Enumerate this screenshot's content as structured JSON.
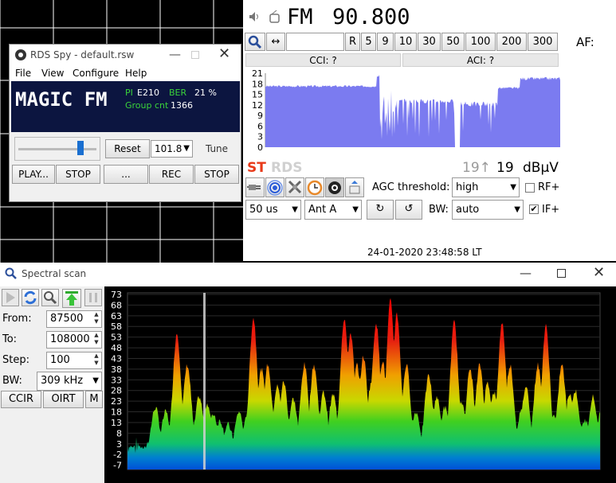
{
  "tuner": {
    "band": "FM",
    "frequency": "90.800",
    "freq_input": "",
    "buttons": [
      "R",
      "5",
      "9",
      "10",
      "30",
      "50",
      "100",
      "200",
      "300"
    ],
    "af_label": "AF:",
    "cci": "CCI: ?",
    "aci": "ACI: ?",
    "st": "ST",
    "rds": "RDS",
    "signal_peak": "19↑",
    "signal": "19",
    "unit": "dBµV",
    "agc_label": "AGC threshold:",
    "agc_value": "high",
    "rf_label": "RF+",
    "if_label": "IF+",
    "deemphasis": "50 us",
    "antenna": "Ant A",
    "bw_label": "BW:",
    "bw_value": "auto",
    "datetime": "24-01-2020 23:48:58 LT",
    "y_ticks": [
      "21",
      "18",
      "15",
      "12",
      "9",
      "6",
      "3",
      "0"
    ],
    "accent_color": "#e83a1a",
    "bar_color": "#7b7bf0"
  },
  "rds": {
    "title": "RDS Spy - default.rsw",
    "menu": [
      "File",
      "View",
      "Configure",
      "Help"
    ],
    "ps": "MAGIC FM",
    "pi_label": "PI",
    "pi": "E210",
    "ber_label": "BER",
    "ber": "21 %",
    "group_label": "Group cnt",
    "group_cnt": "1366",
    "reset": "Reset",
    "freq_select": "101.8",
    "tune": "Tune",
    "play": "PLAY...",
    "stop1": "STOP",
    "dots": "...",
    "rec": "REC",
    "stop2": "STOP",
    "slider_level": 0.82
  },
  "scan": {
    "title": "Spectral scan",
    "from_label": "From:",
    "from": "87500",
    "to_label": "To:",
    "to": "108000",
    "step_label": "Step:",
    "step": "100",
    "bw_label": "BW:",
    "bw": "309 kHz",
    "ccir": "CCIR",
    "oirt": "OIRT",
    "m": "M",
    "y_ticks": [
      "73",
      "68",
      "63",
      "58",
      "53",
      "48",
      "43",
      "38",
      "33",
      "28",
      "23",
      "18",
      "13",
      "8",
      "3",
      "-2",
      "-7"
    ]
  }
}
